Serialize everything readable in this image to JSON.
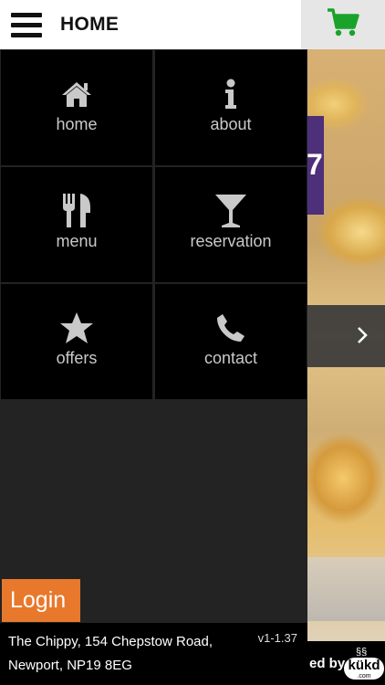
{
  "header": {
    "title": "HOME"
  },
  "menu": {
    "items": [
      {
        "label": "home",
        "icon": "home-icon"
      },
      {
        "label": "about",
        "icon": "info-icon"
      },
      {
        "label": "menu",
        "icon": "fork-knife-icon"
      },
      {
        "label": "reservation",
        "icon": "cocktail-glass-icon"
      },
      {
        "label": "offers",
        "icon": "star-icon"
      },
      {
        "label": "contact",
        "icon": "phone-icon"
      }
    ]
  },
  "login": {
    "label": "Login"
  },
  "footer": {
    "address_line1": "The Chippy, 154 Chepstow Road,",
    "address_line2": "Newport, NP19 8EG",
    "version": "v1-1.37"
  },
  "powered_by": {
    "text": "ed by",
    "logo_text": "kükd",
    "logo_sub": ".com"
  },
  "background": {
    "partial_number": "7"
  },
  "colors": {
    "accent_login": "#e8782c",
    "cart_green": "#1aa32a",
    "tile_bg": "#000000",
    "menu_bg": "#232323"
  }
}
